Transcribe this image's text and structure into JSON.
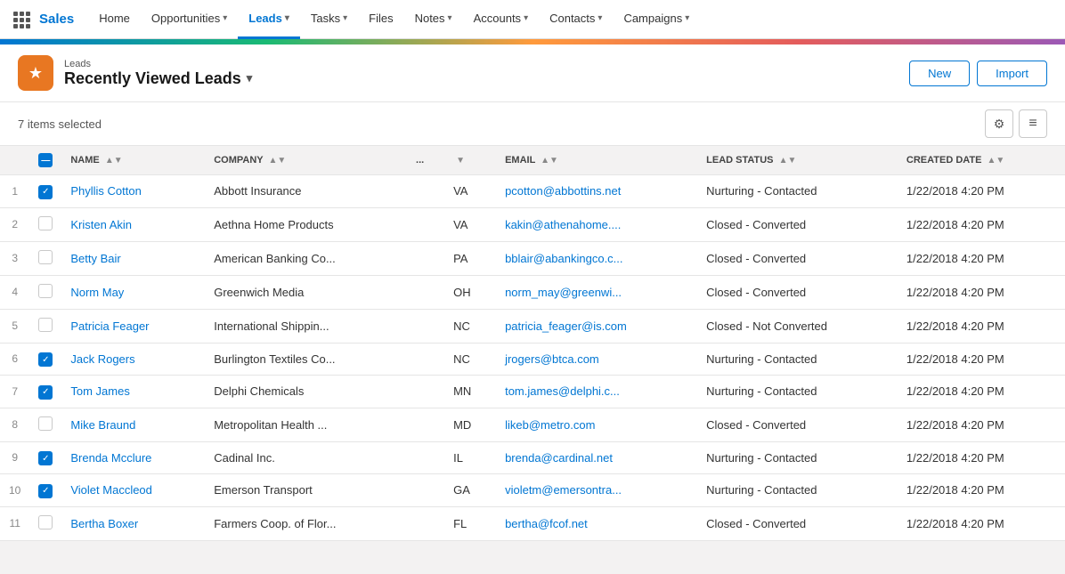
{
  "app": {
    "grid_icon": "grid-icon",
    "name": "Sales"
  },
  "nav": {
    "items": [
      {
        "label": "Home",
        "has_dropdown": false,
        "active": false
      },
      {
        "label": "Opportunities",
        "has_dropdown": true,
        "active": false
      },
      {
        "label": "Leads",
        "has_dropdown": true,
        "active": true
      },
      {
        "label": "Tasks",
        "has_dropdown": true,
        "active": false
      },
      {
        "label": "Files",
        "has_dropdown": false,
        "active": false
      },
      {
        "label": "Notes",
        "has_dropdown": true,
        "active": false
      },
      {
        "label": "Accounts",
        "has_dropdown": true,
        "active": false
      },
      {
        "label": "Contacts",
        "has_dropdown": true,
        "active": false
      },
      {
        "label": "Campaigns",
        "has_dropdown": true,
        "active": false
      }
    ]
  },
  "page_header": {
    "icon": "★",
    "breadcrumb": "Leads",
    "title": "Recently Viewed Leads",
    "new_button": "New",
    "import_button": "Import"
  },
  "toolbar": {
    "items_selected": "7 items selected"
  },
  "table": {
    "columns": [
      {
        "label": "",
        "sortable": false
      },
      {
        "label": "",
        "sortable": false
      },
      {
        "label": "NAME",
        "sortable": true
      },
      {
        "label": "COMPANY",
        "sortable": true
      },
      {
        "label": "...",
        "sortable": false
      },
      {
        "label": "",
        "sortable": true
      },
      {
        "label": "EMAIL",
        "sortable": true
      },
      {
        "label": "LEAD STATUS",
        "sortable": true
      },
      {
        "label": "CREATED DATE",
        "sortable": true
      }
    ],
    "rows": [
      {
        "num": "1",
        "checked": true,
        "name": "Phyllis Cotton",
        "company": "Abbott Insurance",
        "state": "VA",
        "email": "pcotton@abbottins.net",
        "status": "Nurturing - Contacted",
        "created": "1/22/2018 4:20 PM"
      },
      {
        "num": "2",
        "checked": false,
        "name": "Kristen Akin",
        "company": "Aethna Home Products",
        "state": "VA",
        "email": "kakin@athenahome....",
        "status": "Closed - Converted",
        "created": "1/22/2018 4:20 PM"
      },
      {
        "num": "3",
        "checked": false,
        "name": "Betty Bair",
        "company": "American Banking Co...",
        "state": "PA",
        "email": "bblair@abankingco.c...",
        "status": "Closed - Converted",
        "created": "1/22/2018 4:20 PM"
      },
      {
        "num": "4",
        "checked": false,
        "name": "Norm May",
        "company": "Greenwich Media",
        "state": "OH",
        "email": "norm_may@greenwi...",
        "status": "Closed - Converted",
        "created": "1/22/2018 4:20 PM"
      },
      {
        "num": "5",
        "checked": false,
        "name": "Patricia Feager",
        "company": "International Shippin...",
        "state": "NC",
        "email": "patricia_feager@is.com",
        "status": "Closed - Not Converted",
        "created": "1/22/2018 4:20 PM"
      },
      {
        "num": "6",
        "checked": true,
        "name": "Jack Rogers",
        "company": "Burlington Textiles Co...",
        "state": "NC",
        "email": "jrogers@btca.com",
        "status": "Nurturing - Contacted",
        "created": "1/22/2018 4:20 PM"
      },
      {
        "num": "7",
        "checked": true,
        "name": "Tom James",
        "company": "Delphi Chemicals",
        "state": "MN",
        "email": "tom.james@delphi.c...",
        "status": "Nurturing - Contacted",
        "created": "1/22/2018 4:20 PM"
      },
      {
        "num": "8",
        "checked": false,
        "name": "Mike Braund",
        "company": "Metropolitan Health ...",
        "state": "MD",
        "email": "likeb@metro.com",
        "status": "Closed - Converted",
        "created": "1/22/2018 4:20 PM"
      },
      {
        "num": "9",
        "checked": true,
        "name": "Brenda Mcclure",
        "company": "Cadinal Inc.",
        "state": "IL",
        "email": "brenda@cardinal.net",
        "status": "Nurturing - Contacted",
        "created": "1/22/2018 4:20 PM"
      },
      {
        "num": "10",
        "checked": true,
        "name": "Violet Maccleod",
        "company": "Emerson Transport",
        "state": "GA",
        "email": "violetm@emersontra...",
        "status": "Nurturing - Contacted",
        "created": "1/22/2018 4:20 PM"
      },
      {
        "num": "11",
        "checked": false,
        "name": "Bertha Boxer",
        "company": "Farmers Coop. of Flor...",
        "state": "FL",
        "email": "bertha@fcof.net",
        "status": "Closed - Converted",
        "created": "1/22/2018 4:20 PM"
      }
    ]
  }
}
